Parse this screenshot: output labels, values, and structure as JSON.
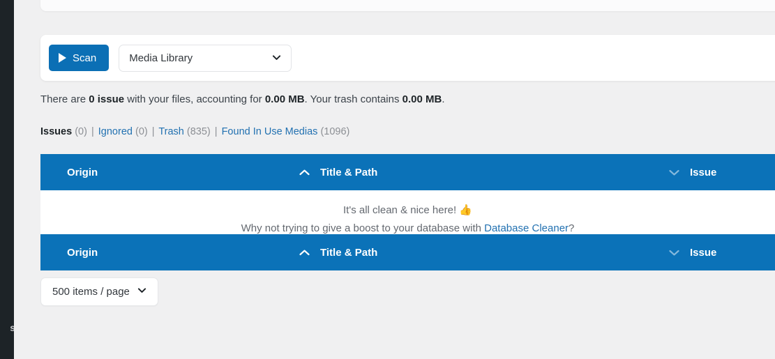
{
  "sidebar": {
    "truncated_label": "s"
  },
  "toolbar": {
    "scan_label": "Scan",
    "play_icon": "play-icon",
    "source_value": "Media Library",
    "source_chevron_icon": "chevron-down-icon"
  },
  "summary": {
    "prefix": "There are ",
    "issue_count": "0 issue",
    "middle": " with your files, accounting for ",
    "issue_size": "0.00 MB",
    "trash_prefix": ". Your trash contains ",
    "trash_size": "0.00 MB",
    "suffix": "."
  },
  "filters": [
    {
      "label": "Issues",
      "count": "(0)",
      "active": true
    },
    {
      "label": "Ignored",
      "count": "(0)",
      "active": false
    },
    {
      "label": "Trash",
      "count": "(835)",
      "active": false
    },
    {
      "label": "Found In Use Medias",
      "count": "(1096)",
      "active": false
    }
  ],
  "table": {
    "columns": {
      "origin": "Origin",
      "title_path": "Title & Path",
      "issue": "Issue"
    },
    "sort_asc_icon": "chevron-up-icon",
    "sort_desc_icon": "chevron-down-icon"
  },
  "empty_state": {
    "line1": "It's all clean & nice here!",
    "thumbs_icon": "👍",
    "line2_prefix": "Why not trying to give a boost to your database with ",
    "line2_link": "Database Cleaner",
    "line2_suffix": "?"
  },
  "pagination": {
    "per_page_value": "500 items / page",
    "chevron_icon": "chevron-down-icon"
  },
  "colors": {
    "accent_blue": "#0b72b8",
    "button_blue": "#0b6fb5",
    "link_blue": "#2271b1",
    "admin_dark": "#1d2327",
    "page_bg": "#f0f0f1"
  }
}
